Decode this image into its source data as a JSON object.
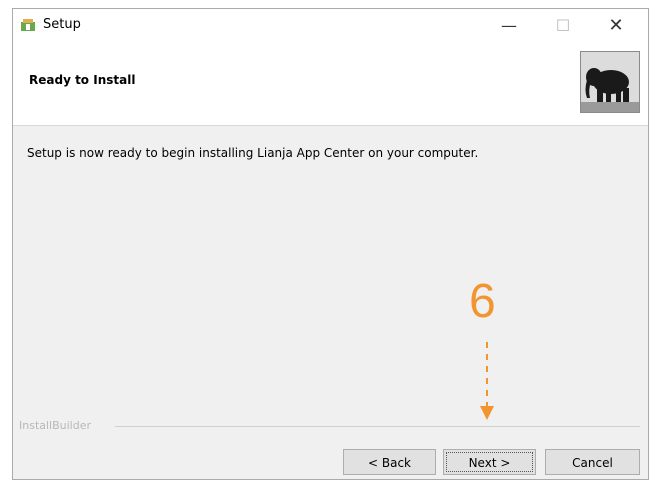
{
  "window": {
    "title": "Setup",
    "icon": "setup-package-icon",
    "controls": {
      "minimize": "—",
      "maximize": "☐",
      "close": "✕"
    }
  },
  "header": {
    "title": "Ready to Install",
    "logo_icon": "elephant-logo-icon"
  },
  "content": {
    "message": "Setup is now ready to begin installing Lianja App Center on your computer."
  },
  "annotation": {
    "step": "6",
    "color": "#f3952f"
  },
  "footer": {
    "brand": "InstallBuilder",
    "buttons": {
      "back": "< Back",
      "next": "Next >",
      "cancel": "Cancel"
    }
  }
}
